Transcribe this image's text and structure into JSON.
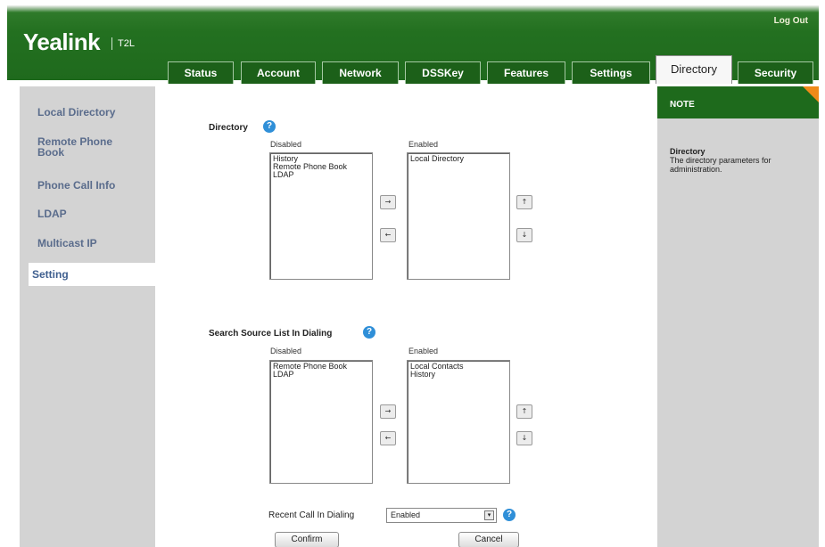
{
  "header": {
    "brand": "Yealink",
    "model": "T2L",
    "logout": "Log Out",
    "tabs": [
      "Status",
      "Account",
      "Network",
      "DSSKey",
      "Features",
      "Settings",
      "Directory",
      "Security"
    ],
    "active_tab": "Directory"
  },
  "sidebar": {
    "items": [
      "Local Directory",
      "Remote Phone Book",
      "Phone Call Info",
      "LDAP",
      "Multicast IP",
      "Setting"
    ],
    "active": "Setting"
  },
  "directory": {
    "title": "Directory",
    "disabled_label": "Disabled",
    "enabled_label": "Enabled",
    "disabled_items": [
      "History",
      "Remote Phone Book",
      "LDAP"
    ],
    "enabled_items": [
      "Local Directory"
    ],
    "left_buttons": [
      "→",
      "←"
    ],
    "right_buttons": [
      "↑",
      "↓"
    ]
  },
  "search_source": {
    "title": "Search Source List In Dialing",
    "disabled_label": "Disabled",
    "enabled_label": "Enabled",
    "disabled_items": [
      "Remote Phone Book",
      "LDAP"
    ],
    "enabled_items": [
      "Local Contacts",
      "History"
    ],
    "left_buttons": [
      "→",
      "←"
    ],
    "right_buttons": [
      "↑",
      "↓"
    ]
  },
  "recent_call": {
    "label": "Recent Call In Dialing",
    "value": "Enabled"
  },
  "actions": {
    "confirm": "Confirm",
    "cancel": "Cancel"
  },
  "note": {
    "title": "NOTE",
    "heading": "Directory",
    "text": "The directory parameters for administration."
  },
  "icons": {
    "help": "?",
    "dropdown": "▾"
  },
  "colors": {
    "header_green": "#237020",
    "note_corner": "#f08a1a",
    "sidebar_link": "#5a6c8c",
    "help_blue": "#2f8fd8"
  }
}
